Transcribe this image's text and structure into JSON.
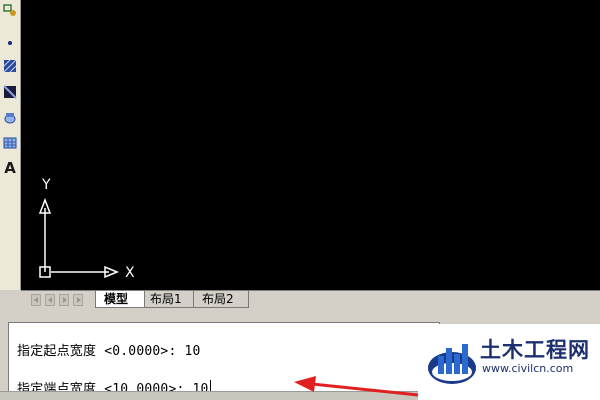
{
  "canvas": {
    "ucs_x_label": "X",
    "ucs_y_label": "Y",
    "background": "#000000",
    "axis_color": "#ffffff"
  },
  "toolbar": {
    "tools": [
      "insert-block-icon",
      "point-icon",
      "hatch-icon",
      "gradient-icon",
      "region-icon",
      "table-icon",
      "multiline-text-icon"
    ],
    "text_tool_glyph": "A"
  },
  "tabs": [
    {
      "label": "模型",
      "active": true
    },
    {
      "label": "布局1",
      "active": false
    },
    {
      "label": "布局2",
      "active": false
    }
  ],
  "command": {
    "line1": "指定起点宽度 <0.0000>: 10",
    "line2": "指定端点宽度 <10.0000>: 10"
  },
  "annotation": {
    "arrow_color": "#e02020"
  },
  "watermark": {
    "brand": "土木工程网",
    "url": "www.civilcn.com"
  }
}
